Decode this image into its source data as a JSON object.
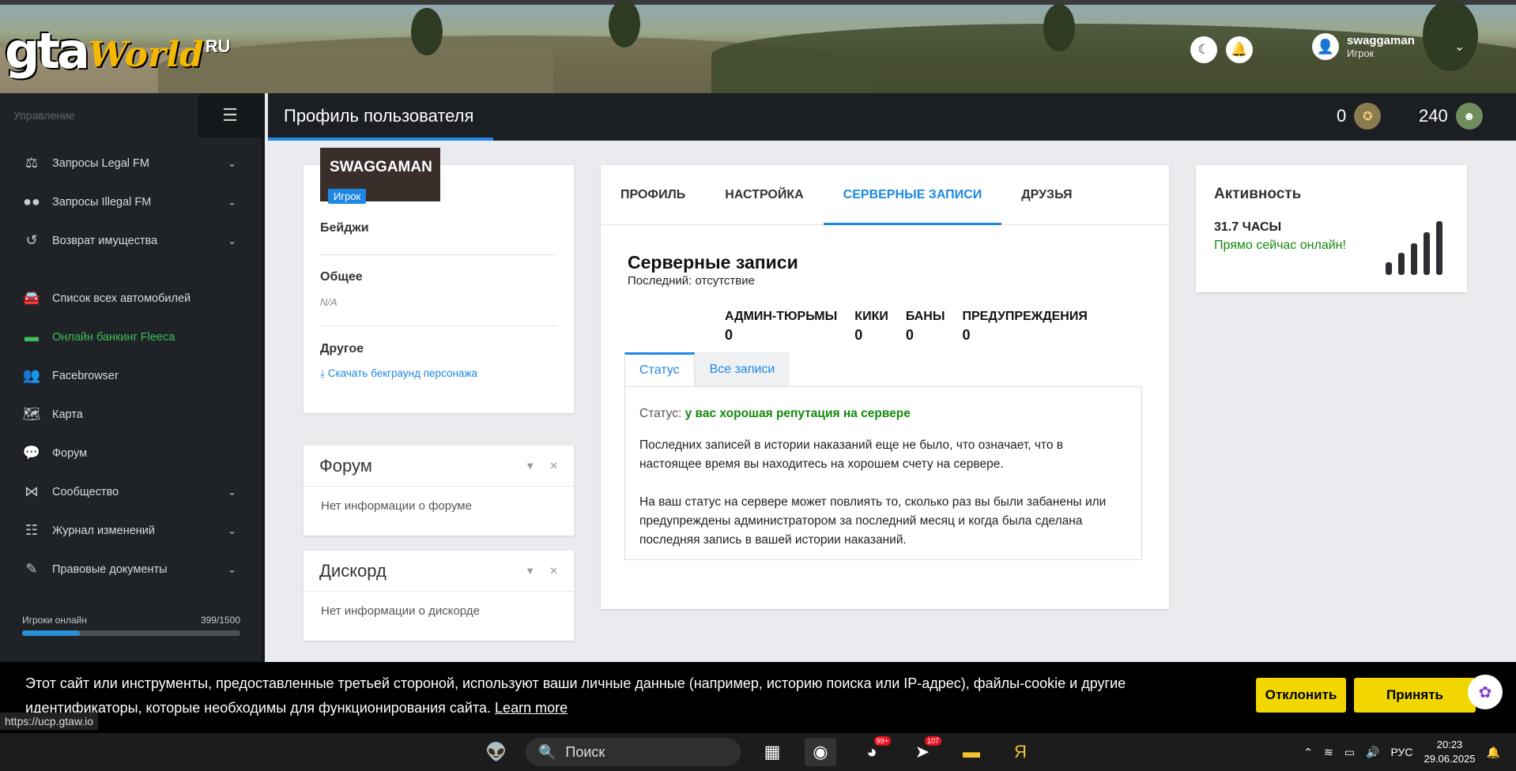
{
  "logo": {
    "gta": "gta",
    "world": "World",
    "ru": "RU"
  },
  "header": {
    "username": "swaggaman",
    "role": "Игрок"
  },
  "sidebar": {
    "section_label": "Управление",
    "items": [
      {
        "label": "Запросы Legal FM",
        "icon": "scales-icon"
      },
      {
        "label": "Запросы Illegal FM",
        "icon": "mask-icon"
      },
      {
        "label": "Возврат имущества",
        "icon": "history-icon"
      },
      {
        "label": "Список всех автомобилей",
        "icon": "car-icon"
      },
      {
        "label": "Онлайн банкинг Fleeca",
        "icon": "money-icon"
      },
      {
        "label": "Facebrowser",
        "icon": "users-icon"
      },
      {
        "label": "Карта",
        "icon": "map-icon"
      },
      {
        "label": "Форум",
        "icon": "comments-icon"
      },
      {
        "label": "Сообщество",
        "icon": "share-icon"
      },
      {
        "label": "Журнал изменений",
        "icon": "list-icon"
      },
      {
        "label": "Правовые документы",
        "icon": "document-icon"
      }
    ],
    "online_label": "Игроки онлайн",
    "online_count": "399/1500",
    "online_fraction": 0.266
  },
  "titlebar": {
    "title": "Профиль пользователя",
    "stat1": "0",
    "stat2": "240"
  },
  "profile_card": {
    "name": "SWAGGAMAN",
    "role": "Игрок",
    "badges": "Бейджи",
    "general": "Общее",
    "general_value": "N/A",
    "other": "Другое",
    "download": "Скачать бекграунд персонажа"
  },
  "forum_widget": {
    "title": "Форум",
    "body": "Нет информации о форуме"
  },
  "discord_widget": {
    "title": "Дискорд",
    "body": "Нет информации о дискорде"
  },
  "main": {
    "tabs": [
      "ПРОФИЛЬ",
      "НАСТРОЙКА",
      "СЕРВЕРНЫЕ ЗАПИСИ",
      "ДРУЗЬЯ"
    ],
    "title": "Серверные записи",
    "last": "Последний: отсутствие",
    "counts": [
      {
        "label": "АДМИН-ТЮРЬМЫ",
        "value": "0"
      },
      {
        "label": "КИКИ",
        "value": "0"
      },
      {
        "label": "БАНЫ",
        "value": "0"
      },
      {
        "label": "ПРЕДУПРЕЖДЕНИЯ",
        "value": "0"
      }
    ],
    "subtabs": [
      "Статус",
      "Все записи"
    ],
    "status_label": "Статус:",
    "status_value": "у вас хорошая репутация на сервере",
    "para1": "Последних записей в истории наказаний еще не было, что означает, что в настоящее время вы находитесь на хорошем счету на сервере.",
    "para2": "На ваш статус на сервере может повлиять то, сколько раз вы были забанены или предупреждены администратором за последний месяц и когда была сделана последняя запись в вашей истории наказаний."
  },
  "activity": {
    "title": "Активность",
    "hours": "31.7 ЧАСЫ",
    "online": "Прямо сейчас онлайн!"
  },
  "cookie": {
    "text": "Этот сайт или инструменты, предоставленные третьей стороной, используют ваши личные данные (например, историю поиска или IP-адрес), файлы-cookie и другие идентификаторы, которые необходимы для функционирования сайта.",
    "learn": "Learn more",
    "decline": "Отклонить",
    "accept": "Принять"
  },
  "url_hint": "https://ucp.gtaw.io",
  "taskbar": {
    "search": "Поиск",
    "lang": "РУС",
    "time": "20:23",
    "date": "29.06.2025",
    "badge1": "99+",
    "badge2": "107"
  }
}
